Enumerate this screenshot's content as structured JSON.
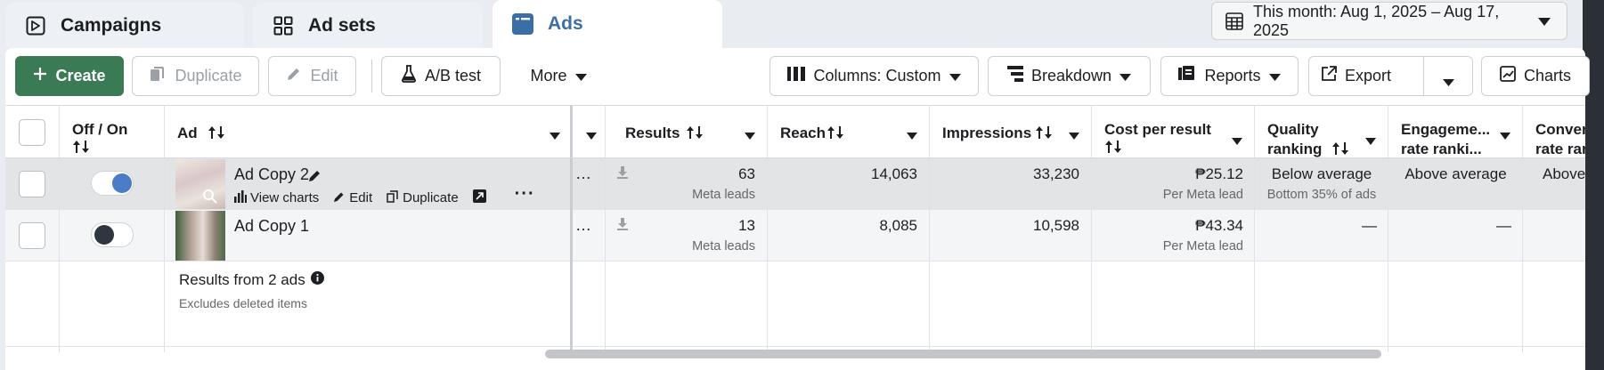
{
  "tabs": [
    {
      "label": "Campaigns",
      "icon": "flag-icon"
    },
    {
      "label": "Ad sets",
      "icon": "grid-icon"
    },
    {
      "label": "Ads",
      "icon": "ad-window-icon"
    }
  ],
  "date_range": {
    "label": "This month: Aug 1, 2025 – Aug 17, 2025"
  },
  "toolbar": {
    "create": "Create",
    "duplicate": "Duplicate",
    "edit": "Edit",
    "ab_test": "A/B test",
    "more": "More",
    "columns": "Columns: Custom",
    "breakdown": "Breakdown",
    "reports": "Reports",
    "export": "Export",
    "charts": "Charts"
  },
  "columns": {
    "off_on": "Off / On",
    "ad": "Ad",
    "results": "Results",
    "reach": "Reach",
    "impressions": "Impressions",
    "cost_per_result_1": "Cost per result",
    "quality_ranking_1": "Quality",
    "quality_ranking_2": "ranking",
    "engagement_1": "Engageme...",
    "engagement_2": "rate ranki...",
    "conversion_1": "Convers",
    "conversion_2": "rate ran"
  },
  "rows": [
    {
      "name": "Ad Copy 2",
      "toggle_on": true,
      "actions": {
        "view_charts": "View charts",
        "edit": "Edit",
        "duplicate": "Duplicate"
      },
      "results": "63",
      "results_sub": "Meta leads",
      "reach": "14,063",
      "impressions": "33,230",
      "cost": "₱25.12",
      "cost_sub": "Per Meta lead",
      "quality": "Below average",
      "quality_sub": "Bottom 35% of ads",
      "engagement": "Above average",
      "conversion": "Above"
    },
    {
      "name": "Ad Copy 1",
      "toggle_on": false,
      "results": "13",
      "results_sub": "Meta leads",
      "reach": "8,085",
      "impressions": "10,598",
      "cost": "₱43.34",
      "cost_sub": "Per Meta lead",
      "quality": "—",
      "engagement": "—",
      "conversion": ""
    }
  ],
  "summary": {
    "title": "Results from 2 ads",
    "subtitle": "Excludes deleted items"
  },
  "colors": {
    "accent_blue": "#3b6ea5",
    "create_green": "#3a7a55",
    "toggle_on": "#4a7cc7"
  }
}
